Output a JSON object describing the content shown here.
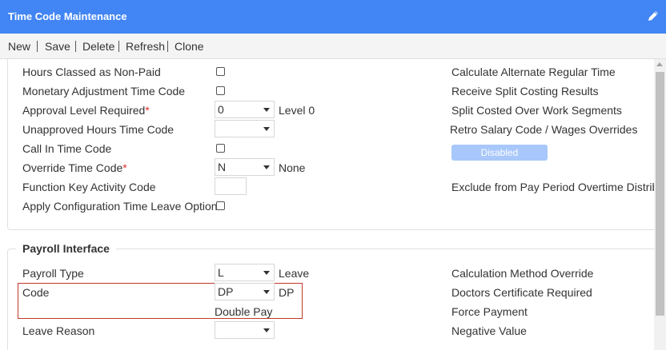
{
  "window": {
    "title": "Time Code Maintenance"
  },
  "toolbar": {
    "new": "New",
    "save": "Save",
    "delete": "Delete",
    "refresh": "Refresh",
    "clone": "Clone"
  },
  "left": {
    "hours_non_paid": "Hours Classed as Non-Paid",
    "monetary_adj": "Monetary Adjustment Time Code",
    "approval_level": "Approval Level Required",
    "approval_value": "0",
    "approval_desc": "Level 0",
    "unapproved": "Unapproved Hours Time Code",
    "unapproved_value": "",
    "call_in": "Call In Time Code",
    "override": "Override Time Code",
    "override_value": "N",
    "override_desc": "None",
    "function_key": "Function Key Activity Code",
    "function_key_value": "",
    "apply_config": "Apply Configuration Time Leave Options"
  },
  "right": {
    "calc_alt": "Calculate Alternate Regular Time",
    "receive_split": "Receive Split Costing Results",
    "split_costed": "Split Costed Over Work Segments",
    "retro": "Retro Salary Code / Wages Overrides",
    "disabled_btn": "Disabled",
    "exclude": "Exclude from Pay Period Overtime Distribu"
  },
  "payroll": {
    "legend": "Payroll Interface",
    "payroll_type": "Payroll Type",
    "payroll_type_value": "L",
    "payroll_type_desc": "Leave",
    "code": "Code",
    "code_value": "DP",
    "code_desc": "DP",
    "code_full": "Double Pay",
    "leave_reason": "Leave Reason",
    "leave_reason_value": "",
    "calc_method": "Calculation Method Override",
    "doctors_cert": "Doctors Certificate Required",
    "force_payment": "Force Payment",
    "negative_value": "Negative Value"
  },
  "required_marker": "*",
  "colors": {
    "titlebar": "#4285f4",
    "disabled_button": "#a8c7fa",
    "highlight": "#c0392b",
    "required": "#e03030"
  }
}
